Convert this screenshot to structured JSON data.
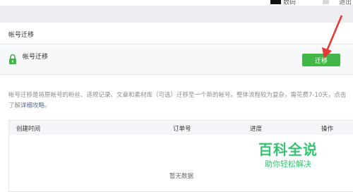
{
  "topbar": {
    "link1": "数码",
    "link2": "退出"
  },
  "section": {
    "title": "帐号迁移"
  },
  "panel": {
    "label": "帐号迁移",
    "button_label": "迁移"
  },
  "description": {
    "text": "帐号迁移是将原帐号的粉丝、违规记录、文章和素材库（可选）迁移至一个新的帐号。整体流程较为复杂，需花费7-10天，点击了解",
    "link": "详细攻略",
    "suffix": "。"
  },
  "table": {
    "columns": [
      "创建时间",
      "订单号",
      "进度",
      "操作"
    ],
    "empty_text": "暂无数据"
  },
  "watermark": {
    "title": "百科全说",
    "subtitle": "助你轻松解决"
  },
  "colors": {
    "accent": "#44b549",
    "arrow": "#e53935",
    "link": "#576b95"
  },
  "icons": [
    "lock-icon",
    "arrow-icon"
  ]
}
